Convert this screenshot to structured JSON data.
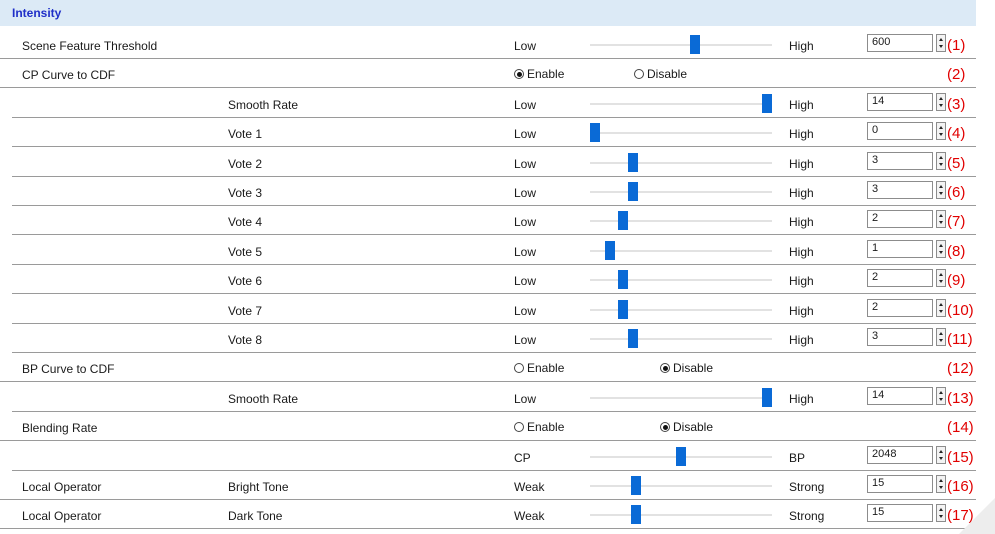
{
  "section_title": "Intensity",
  "rows": [
    {
      "type": "slider",
      "label1": "Scene Feature Threshold",
      "label2": "",
      "low": "Low",
      "high": "High",
      "position": 0.58,
      "value": "600",
      "note": "(1)"
    },
    {
      "type": "radio",
      "label1": "CP Curve to CDF",
      "label2": "",
      "enable": "Enable",
      "disable": "Disable",
      "selected": "enable",
      "note": "(2)"
    },
    {
      "type": "slider",
      "label1": "",
      "label2": "Smooth Rate",
      "low": "Low",
      "high": "High",
      "position": 1.0,
      "value": "14",
      "note": "(3)",
      "sub": true
    },
    {
      "type": "slider",
      "label1": "",
      "label2": "Vote 1",
      "low": "Low",
      "high": "High",
      "position": 0.0,
      "value": "0",
      "note": "(4)",
      "sub": true
    },
    {
      "type": "slider",
      "label1": "",
      "label2": "Vote 2",
      "low": "Low",
      "high": "High",
      "position": 0.22,
      "value": "3",
      "note": "(5)",
      "sub": true
    },
    {
      "type": "slider",
      "label1": "",
      "label2": "Vote 3",
      "low": "Low",
      "high": "High",
      "position": 0.22,
      "value": "3",
      "note": "(6)",
      "sub": true
    },
    {
      "type": "slider",
      "label1": "",
      "label2": "Vote 4",
      "low": "Low",
      "high": "High",
      "position": 0.16,
      "value": "2",
      "note": "(7)",
      "sub": true
    },
    {
      "type": "slider",
      "label1": "",
      "label2": "Vote 5",
      "low": "Low",
      "high": "High",
      "position": 0.09,
      "value": "1",
      "note": "(8)",
      "sub": true
    },
    {
      "type": "slider",
      "label1": "",
      "label2": "Vote 6",
      "low": "Low",
      "high": "High",
      "position": 0.16,
      "value": "2",
      "note": "(9)",
      "sub": true
    },
    {
      "type": "slider",
      "label1": "",
      "label2": "Vote 7",
      "low": "Low",
      "high": "High",
      "position": 0.16,
      "value": "2",
      "note": "(10)",
      "sub": true
    },
    {
      "type": "slider",
      "label1": "",
      "label2": "Vote 8",
      "low": "Low",
      "high": "High",
      "position": 0.22,
      "value": "3",
      "note": "(11)",
      "sub": true
    },
    {
      "type": "radio",
      "label1": "BP Curve to CDF",
      "label2": "",
      "enable": "Enable",
      "disable": "Disable",
      "selected": "disable",
      "note": "(12)"
    },
    {
      "type": "slider",
      "label1": "",
      "label2": "Smooth Rate",
      "low": "Low",
      "high": "High",
      "position": 1.0,
      "value": "14",
      "note": "(13)",
      "sub": true
    },
    {
      "type": "radio",
      "label1": "Blending Rate",
      "label2": "",
      "enable": "Enable",
      "disable": "Disable",
      "selected": "disable",
      "note": "(14)"
    },
    {
      "type": "slider",
      "label1": "",
      "label2": "",
      "low": "CP",
      "high": "BP",
      "position": 0.5,
      "value": "2048",
      "note": "(15)",
      "sub": true
    },
    {
      "type": "slider",
      "label1": "Local Operator",
      "label2": "Bright Tone",
      "low": "Weak",
      "high": "Strong",
      "position": 0.24,
      "value": "15",
      "note": "(16)"
    },
    {
      "type": "slider",
      "label1": "Local Operator",
      "label2": "Dark Tone",
      "low": "Weak",
      "high": "Strong",
      "position": 0.24,
      "value": "15",
      "note": "(17)"
    }
  ]
}
